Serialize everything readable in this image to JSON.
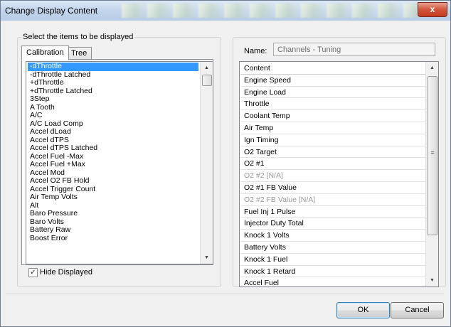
{
  "window": {
    "title": "Change Display Content",
    "close_glyph": "x"
  },
  "left": {
    "section_label": "Select the items to be displayed",
    "tabs": [
      {
        "label": "Calibration"
      },
      {
        "label": "Tree"
      }
    ],
    "items": [
      "-dThrottle",
      "-dThrottle Latched",
      "+dThrottle",
      "+dThrottle Latched",
      "3Step",
      "A Tooth",
      "A/C",
      "A/C Load Comp",
      "Accel dLoad",
      "Accel dTPS",
      "Accel dTPS Latched",
      "Accel Fuel -Max",
      "Accel Fuel +Max",
      "Accel Mod",
      "Accel O2 FB Hold",
      "Accel Trigger Count",
      "Air Temp Volts",
      "Alt",
      "Baro Pressure",
      "Baro Volts",
      "Battery Raw",
      "Boost Error"
    ],
    "selected_index": 0,
    "hide_displayed": {
      "label": "Hide Displayed",
      "checked": true
    }
  },
  "right": {
    "name_label": "Name:",
    "name_value": "Channels - Tuning",
    "header": "Content",
    "rows": [
      {
        "label": "Engine Speed",
        "disabled": false
      },
      {
        "label": "Engine Load",
        "disabled": false
      },
      {
        "label": "Throttle",
        "disabled": false
      },
      {
        "label": "Coolant Temp",
        "disabled": false
      },
      {
        "label": "Air Temp",
        "disabled": false
      },
      {
        "label": "Ign Timing",
        "disabled": false
      },
      {
        "label": "O2 Target",
        "disabled": false
      },
      {
        "label": "O2 #1",
        "disabled": false
      },
      {
        "label": "O2 #2 [N/A]",
        "disabled": true
      },
      {
        "label": "O2 #1 FB Value",
        "disabled": false
      },
      {
        "label": "O2 #2 FB Value [N/A]",
        "disabled": true
      },
      {
        "label": "Fuel Inj 1 Pulse",
        "disabled": false
      },
      {
        "label": "Injector Duty Total",
        "disabled": false
      },
      {
        "label": "Knock 1 Volts",
        "disabled": false
      },
      {
        "label": "Battery Volts",
        "disabled": false
      },
      {
        "label": "Knock 1 Fuel",
        "disabled": false
      },
      {
        "label": "Knock 1 Retard",
        "disabled": false
      },
      {
        "label": "Accel Fuel",
        "disabled": false
      }
    ]
  },
  "buttons": {
    "ok": "OK",
    "cancel": "Cancel"
  },
  "icons": {
    "scroll_up": "▲",
    "scroll_down": "▼",
    "grip": "≡",
    "check": "✓"
  },
  "colors": {
    "selection": "#3399ff",
    "close": "#c23a1f",
    "disabled_text": "#9a9a9a"
  }
}
